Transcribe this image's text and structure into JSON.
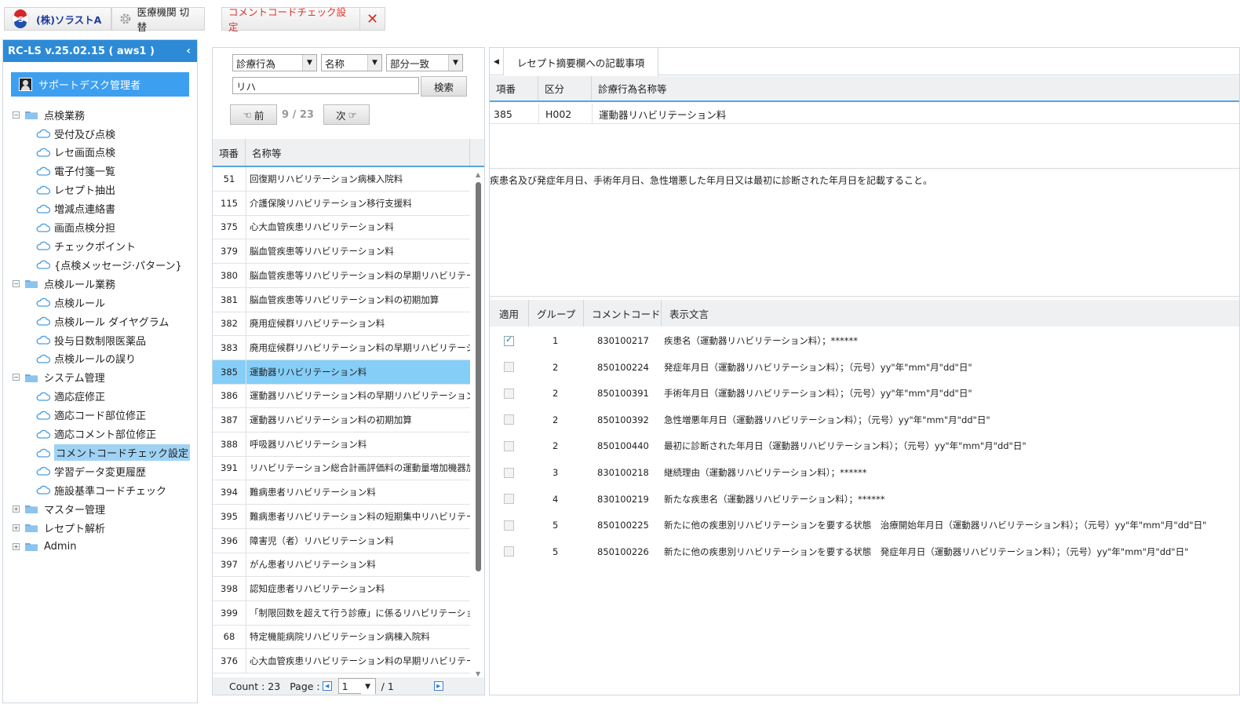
{
  "topbar": {
    "company": "(株)ソラストA",
    "switch_label": "医療機関 切替",
    "active_page_label": "コメントコードチェック設定"
  },
  "sidebar": {
    "version": "RC-LS v.25.02.15 ( aws1 )",
    "user": "サポートデスク管理者",
    "tree": [
      {
        "label": "点検業務",
        "expanded": true,
        "children": [
          "受付及び点検",
          "レセ画面点検",
          "電子付箋一覧",
          "レセプト抽出",
          "増減点連絡書",
          "画面点検分担",
          "チェックポイント",
          "{点検メッセージ·パターン}"
        ]
      },
      {
        "label": "点検ルール業務",
        "expanded": true,
        "children": [
          "点検ルール",
          "点検ルール ダイヤグラム",
          "投与日数制限医薬品",
          "点検ルールの誤り"
        ]
      },
      {
        "label": "システム管理",
        "expanded": true,
        "children": [
          "適応症修正",
          "適応コード部位修正",
          "適応コメント部位修正",
          "コメントコードチェック設定",
          "学習データ変更履歴",
          "施設基準コードチェック"
        ]
      },
      {
        "label": "マスター管理",
        "expanded": false,
        "children": []
      },
      {
        "label": "レセプト解析",
        "expanded": false,
        "children": []
      },
      {
        "label": "Admin",
        "expanded": false,
        "children": []
      }
    ],
    "selected_item": "コメントコードチェック設定"
  },
  "search": {
    "category": "診療行為",
    "field": "名称",
    "match": "部分一致",
    "query": "リハ",
    "search_button": "検索",
    "prev_button": "前",
    "next_button": "次",
    "current": "9",
    "total": "23"
  },
  "list": {
    "headers": [
      "項番",
      "名称等"
    ],
    "rows": [
      [
        "51",
        "回復期リハビリテーション病棟入院料"
      ],
      [
        "115",
        "介護保険リハビリテーション移行支援料"
      ],
      [
        "375",
        "心大血管疾患リハビリテーション料"
      ],
      [
        "379",
        "脳血管疾患等リハビリテーション料"
      ],
      [
        "380",
        "脳血管疾患等リハビリテーション料の早期リハビリテーシ"
      ],
      [
        "381",
        "脳血管疾患等リハビリテーション料の初期加算"
      ],
      [
        "382",
        "廃用症候群リハビリテーション料"
      ],
      [
        "383",
        "廃用症候群リハビリテーション料の早期リハビリテーショ"
      ],
      [
        "385",
        "運動器リハビリテーション料"
      ],
      [
        "386",
        "運動器リハビリテーション料の早期リハビリテーション加"
      ],
      [
        "387",
        "運動器リハビリテーション料の初期加算"
      ],
      [
        "388",
        "呼吸器リハビリテーション料"
      ],
      [
        "391",
        "リハビリテーション総合計画評価料の運動量増加機器加算"
      ],
      [
        "394",
        "難病患者リハビリテーション料"
      ],
      [
        "395",
        "難病患者リハビリテーション料の短期集中リハビリテーシ"
      ],
      [
        "396",
        "障害児（者）リハビリテーション料"
      ],
      [
        "397",
        "がん患者リハビリテーション料"
      ],
      [
        "398",
        "認知症患者リハビリテーション料"
      ],
      [
        "399",
        "「制限回数を超えて行う診療」に係るリハビリテーション"
      ],
      [
        "68",
        "特定機能病院リハビリテーション病棟入院料"
      ],
      [
        "376",
        "心大血管疾患リハビリテーション料の早期リハビリテーシ"
      ]
    ],
    "selected_index": 8,
    "count_label": "Count : 23",
    "page_label": "Page :",
    "page": "1",
    "page_total": "/   1"
  },
  "detail": {
    "tab": "レセプト摘要欄への記載事項",
    "headers": [
      "項番",
      "区分",
      "診療行為名称等"
    ],
    "row": [
      "385",
      "H002",
      "運動器リハビリテーション料"
    ],
    "note": "疾患名及び発症年月日、手術年月日、急性増悪した年月日又は最初に診断された年月日を記載すること。"
  },
  "comments": {
    "headers": [
      "適用",
      "グループ",
      "コメントコード",
      "表示文言"
    ],
    "rows": [
      {
        "checked": true,
        "group": "1",
        "code": "830100217",
        "text": "疾患名（運動器リハビリテーション料）；******"
      },
      {
        "checked": false,
        "group": "2",
        "code": "850100224",
        "text": "発症年月日（運動器リハビリテーション料）；（元号）yy\"年\"mm\"月\"dd\"日\""
      },
      {
        "checked": false,
        "group": "2",
        "code": "850100391",
        "text": "手術年月日（運動器リハビリテーション料）；（元号）yy\"年\"mm\"月\"dd\"日\""
      },
      {
        "checked": false,
        "group": "2",
        "code": "850100392",
        "text": "急性増悪年月日（運動器リハビリテーション料）；（元号）yy\"年\"mm\"月\"dd\"日\""
      },
      {
        "checked": false,
        "group": "2",
        "code": "850100440",
        "text": "最初に診断された年月日（運動器リハビリテーション料）；（元号）yy\"年\"mm\"月\"dd\"日\""
      },
      {
        "checked": false,
        "group": "3",
        "code": "830100218",
        "text": "継続理由（運動器リハビリテーション料）；******"
      },
      {
        "checked": false,
        "group": "4",
        "code": "830100219",
        "text": "新たな疾患名（運動器リハビリテーション料）；******"
      },
      {
        "checked": false,
        "group": "5",
        "code": "850100225",
        "text": "新たに他の疾患別リハビリテーションを要する状態　治療開始年月日（運動器リハビリテーション料）；（元号）yy\"年\"mm\"月\"dd\"日\""
      },
      {
        "checked": false,
        "group": "5",
        "code": "850100226",
        "text": "新たに他の疾患別リハビリテーションを要する状態　発症年月日（運動器リハビリテーション料）；（元号）yy\"年\"mm\"月\"dd\"日\""
      }
    ]
  },
  "colors": {
    "accent": "#2d8ad6",
    "selected_row": "#85cef8",
    "danger": "#e0322a"
  }
}
